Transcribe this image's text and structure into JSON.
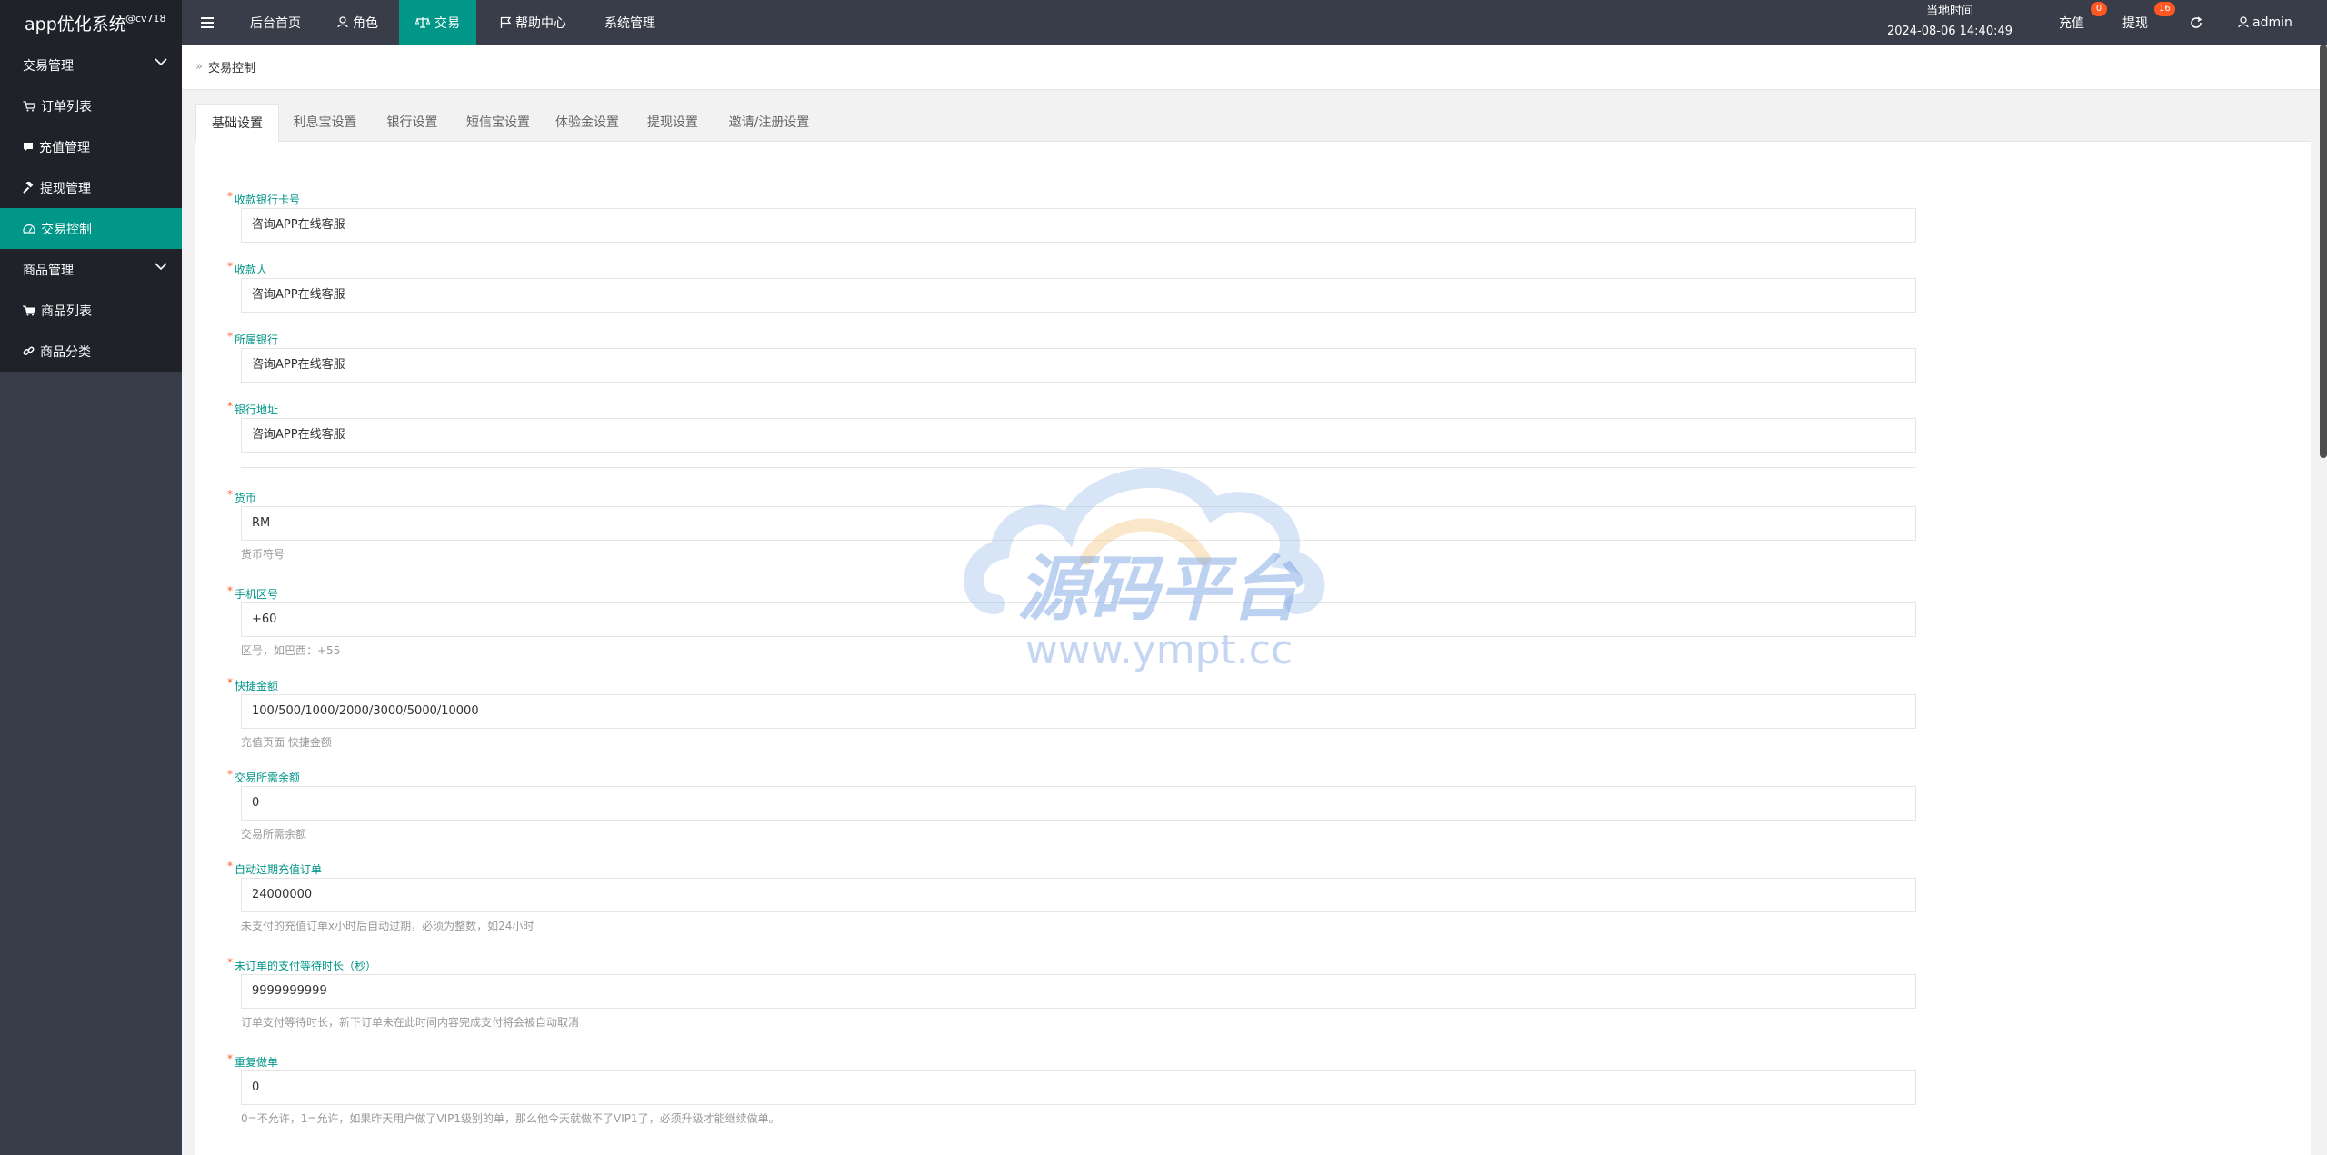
{
  "app": {
    "title": "app优化系统",
    "version": "@cv718"
  },
  "nav": [
    {
      "label": "后台首页",
      "icon": ""
    },
    {
      "label": "角色",
      "icon": "user-icon"
    },
    {
      "label": "交易",
      "icon": "scale-icon"
    },
    {
      "label": "帮助中心",
      "icon": "flag-icon"
    },
    {
      "label": "系统管理",
      "icon": ""
    }
  ],
  "header": {
    "time_label": "当地时间",
    "time_value": "2024-08-06 14:40:49",
    "recharge_label": "充值",
    "recharge_count": "0",
    "withdraw_label": "提现",
    "withdraw_count": "16",
    "user": "admin"
  },
  "sidebar": {
    "groups": [
      {
        "label": "交易管理",
        "items": [
          "订单列表",
          "充值管理",
          "提现管理",
          "交易控制"
        ]
      },
      {
        "label": "商品管理",
        "items": [
          "商品列表",
          "商品分类"
        ]
      }
    ]
  },
  "breadcrumb": {
    "sep": "»",
    "current": "交易控制"
  },
  "tabs": [
    "基础设置",
    "利息宝设置",
    "银行设置",
    "短信宝设置",
    "体验金设置",
    "提现设置",
    "邀请/注册设置"
  ],
  "form": {
    "fields": [
      {
        "label": "收款银行卡号",
        "value": "咨询APP在线客服",
        "help": ""
      },
      {
        "label": "收款人",
        "value": "咨询APP在线客服",
        "help": ""
      },
      {
        "label": "所属银行",
        "value": "咨询APP在线客服",
        "help": ""
      },
      {
        "label": "银行地址",
        "value": "咨询APP在线客服",
        "help": ""
      },
      {
        "label": "货币",
        "value": "RM",
        "help": "货币符号"
      },
      {
        "label": "手机区号",
        "value": "+60",
        "help": "区号，如巴西：+55"
      },
      {
        "label": "快捷金额",
        "value": "100/500/1000/2000/3000/5000/10000",
        "help": "充值页面 快捷金额"
      },
      {
        "label": "交易所需余额",
        "value": "0",
        "help": "交易所需余额"
      },
      {
        "label": "自动过期充值订单",
        "value": "24000000",
        "help": "未支付的充值订单x小时后自动过期，必须为整数，如24小时"
      },
      {
        "label": "未订单的支付等待时长（秒）",
        "value": "9999999999",
        "help": "订单支付等待时长，新下订单未在此时间内容完成支付将会被自动取消"
      },
      {
        "label": "重复做单",
        "value": "0",
        "help": "0=不允许，1=允许，如果昨天用户做了VIP1级别的单，那么他今天就做不了VIP1了，必须升级才能继续做单。"
      }
    ]
  },
  "watermark": {
    "title": "源码平台",
    "url": "www.ympt.cc"
  },
  "colors": {
    "header": "#393d49",
    "sidebar": "#20222a",
    "accent": "#009688",
    "badge": "#ff5722"
  }
}
